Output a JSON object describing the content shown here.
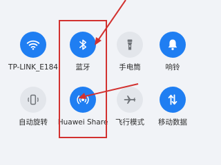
{
  "colors": {
    "background": "#f1f3f7",
    "active_tile": "#1f7ef2",
    "inactive_tile": "#e3e6eb",
    "active_icon": "#ffffff",
    "inactive_icon": "#6f7378",
    "annotation_red": "#d2312f"
  },
  "tiles": [
    {
      "label": "TP-LINK_E184",
      "icon": "wifi-icon",
      "active": true
    },
    {
      "label": "蓝牙",
      "icon": "bluetooth-icon",
      "active": true
    },
    {
      "label": "手电筒",
      "icon": "flashlight-icon",
      "active": false
    },
    {
      "label": "响铃",
      "icon": "bell-icon",
      "active": true
    },
    {
      "label": "自动旋转",
      "icon": "auto-rotate-icon",
      "active": false
    },
    {
      "label": "Huawei Share",
      "icon": "huawei-share-icon",
      "active": true
    },
    {
      "label": "飞行模式",
      "icon": "airplane-icon",
      "active": false
    },
    {
      "label": "移动数据",
      "icon": "mobile-data-icon",
      "active": true
    }
  ]
}
